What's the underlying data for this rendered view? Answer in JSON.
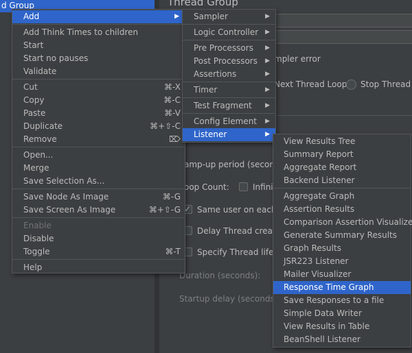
{
  "tree": {
    "selected_label": "d Group"
  },
  "content": {
    "title": "Thread Group",
    "action_label": "mpler error",
    "radio_next_loop": "Next Thread Loop",
    "radio_stop_thread": "Stop Thread",
    "rampup_label": "amp-up period (seconds",
    "loop_count_label": "oop Count:",
    "infinite_label": "Infinit",
    "same_user_label": "Same user on each it",
    "delay_creation_label": "Delay Thread creatio",
    "specify_lifetime_label": "Specify Thread lifetin",
    "duration_label": "Duration (seconds):",
    "startup_delay_label": "Startup delay (seconds):"
  },
  "main_menu": {
    "add": "Add",
    "add_think_times": "Add Think Times to children",
    "start": "Start",
    "start_no_pauses": "Start no pauses",
    "validate": "Validate",
    "cut": "Cut",
    "cut_shortcut": "⌘-X",
    "copy": "Copy",
    "copy_shortcut": "⌘-C",
    "paste": "Paste",
    "paste_shortcut": "⌘-V",
    "duplicate": "Duplicate",
    "duplicate_shortcut": "⌘+⇧-C",
    "remove": "Remove",
    "remove_shortcut": "⌦",
    "open": "Open...",
    "merge": "Merge",
    "save_selection": "Save Selection As...",
    "save_node_image": "Save Node As Image",
    "save_node_image_shortcut": "⌘-G",
    "save_screen_image": "Save Screen As Image",
    "save_screen_image_shortcut": "⌘+⇧-G",
    "enable": "Enable",
    "disable": "Disable",
    "toggle": "Toggle",
    "toggle_shortcut": "⌘-T",
    "help": "Help"
  },
  "add_menu": {
    "sampler": "Sampler",
    "logic_controller": "Logic Controller",
    "pre_processors": "Pre Processors",
    "post_processors": "Post Processors",
    "assertions": "Assertions",
    "timer": "Timer",
    "test_fragment": "Test Fragment",
    "config_element": "Config Element",
    "listener": "Listener"
  },
  "listener_menu": {
    "items_group1": [
      "View Results Tree",
      "Summary Report",
      "Aggregate Report",
      "Backend Listener"
    ],
    "items_group2": [
      "Aggregate Graph",
      "Assertion Results",
      "Comparison Assertion Visualizer",
      "Generate Summary Results",
      "Graph Results",
      "JSR223 Listener",
      "Mailer Visualizer",
      "Response Time Graph",
      "Save Responses to a file",
      "Simple Data Writer",
      "View Results in Table",
      "BeanShell Listener"
    ],
    "selected": "Response Time Graph"
  },
  "icons": {
    "submenu": "chevron-right-icon",
    "check": "check-icon"
  },
  "colors": {
    "selection": "#2f65ca",
    "background": "#3c3f41"
  }
}
